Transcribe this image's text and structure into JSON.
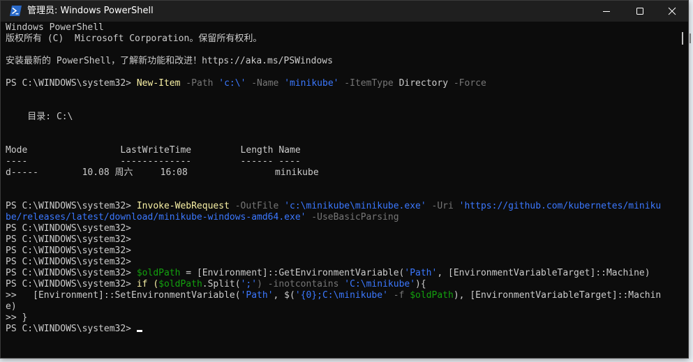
{
  "window": {
    "title": "管理员: Windows PowerShell",
    "icon": "powershell-icon",
    "controls": [
      "minimize-icon",
      "maximize-icon",
      "close-icon"
    ]
  },
  "console": {
    "banner_line1": "Windows PowerShell",
    "banner_line2": "版权所有 (C)  Microsoft Corporation。保留所有权利。",
    "banner_line3": "安装最新的 PowerShell，了解新功能和改进！https://aka.ms/PSWindows",
    "prompt": "PS C:\\WINDOWS\\system32> ",
    "cmd1": {
      "command": "New-Item",
      "p1": " -Path ",
      "v1": "'c:\\'",
      "p2": " -Name ",
      "v2": "'minikube'",
      "p3": " -ItemType ",
      "v3": "Directory",
      "p4": " -Force"
    },
    "dir_header": "    目录: C:\\",
    "table": {
      "header": "Mode                 LastWriteTime         Length Name",
      "rule": "----                 -------------         ------ ----",
      "row": "d-----        10.08 周六     16:08                minikube"
    },
    "cmd2": {
      "command": "Invoke-WebRequest",
      "p1": " -OutFile ",
      "v1": "'c:\\minikube\\minikube.exe'",
      "p2": " -Uri ",
      "v2a": "'https://github.com/kubernetes/miniku",
      "v2b": "be/releases/latest/download/minikube-windows-amd64.exe'",
      "p3": " -UseBasicParsing"
    },
    "empty_prompt": "PS C:\\WINDOWS\\system32>",
    "cmd3": {
      "var": "$oldPath",
      "rest1": " = [Environment]::GetEnvironmentVariable(",
      "s1": "'Path'",
      "rest2": ", [EnvironmentVariableTarget]::Machine)"
    },
    "cmd4": {
      "kw": "if (",
      "var": "$oldPath",
      "rest1": ".Split(",
      "s1": "';'",
      "p1": ") -inotcontains ",
      "s2": "'C:\\minikube'",
      "rest2": "){"
    },
    "cmd5": {
      "cont": ">>   ",
      "rest1": "[Environment]::SetEnvironmentVariable(",
      "s1": "'Path'",
      "rest2": ", $(",
      "s2": "'{0};C:\\minikube'",
      "p1": " -f ",
      "var": "$oldPath",
      "rest3": "), [EnvironmentVariableTarget]::Machin",
      "wrap": "e)"
    },
    "cmd6": ">> }",
    "final_prompt": "PS C:\\WINDOWS\\system32> "
  },
  "colors": {
    "background": "#0c0c0c",
    "text": "#cccccc",
    "command": "#f9f1a5",
    "parameter": "#767676",
    "string": "#3b78ff",
    "variable": "#13a10e",
    "titlebar": "#1f1f1f"
  }
}
